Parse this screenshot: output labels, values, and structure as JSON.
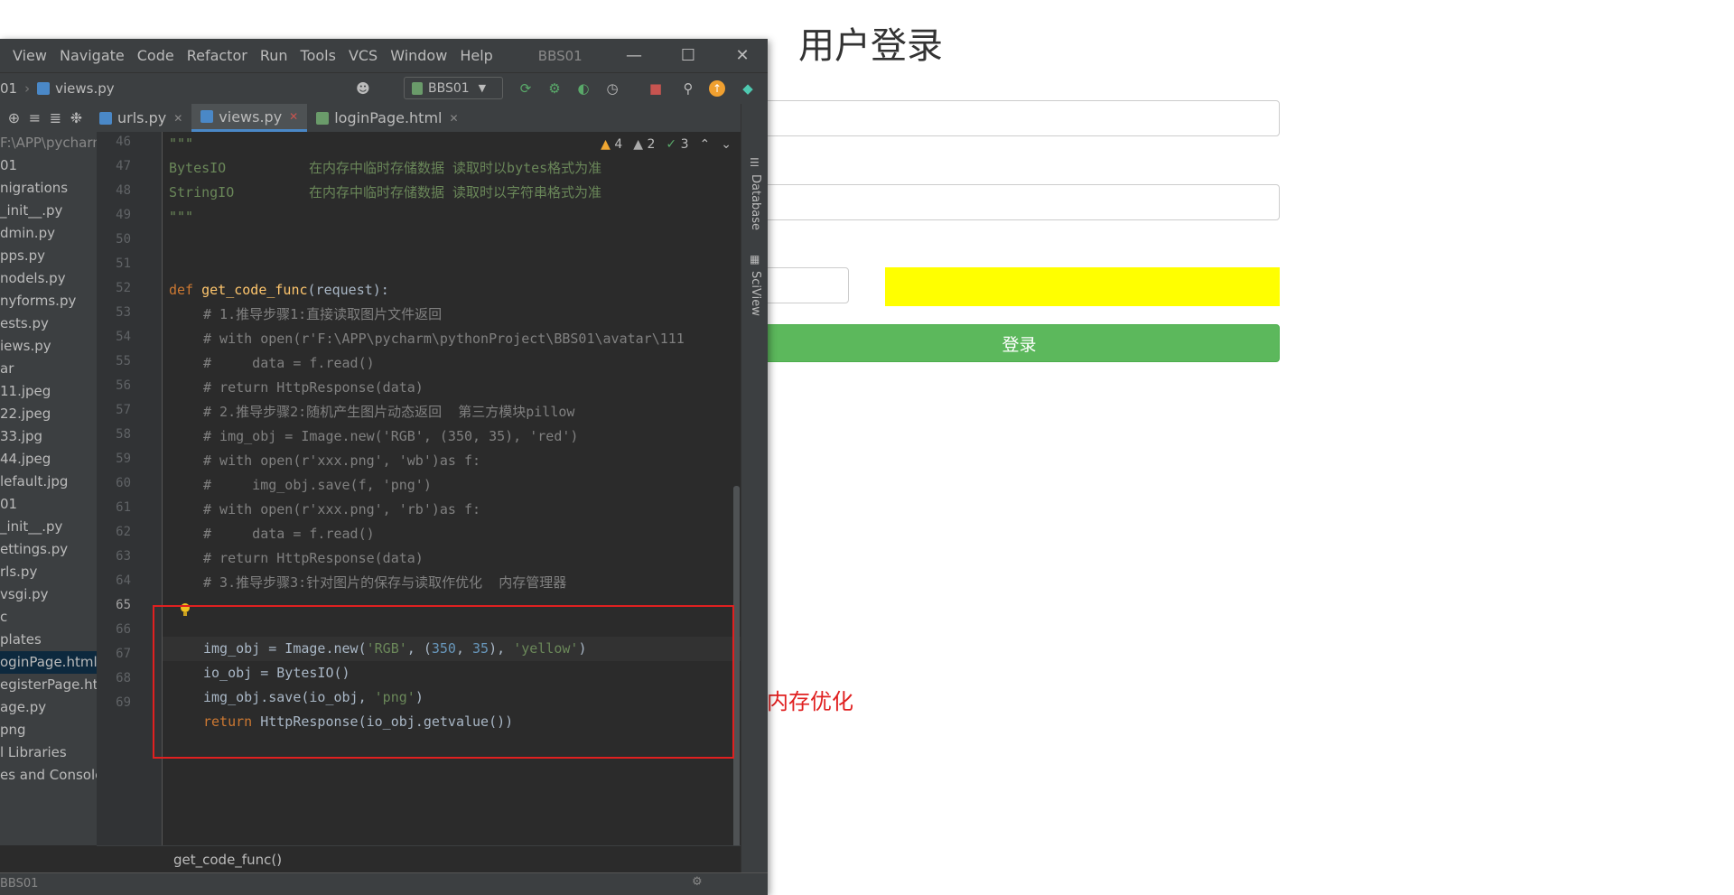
{
  "browser": {
    "title": "用户登录",
    "login_button": "登录",
    "annotation": "内存优化"
  },
  "ide": {
    "menu": [
      "View",
      "Navigate",
      "Code",
      "Refactor",
      "Run",
      "Tools",
      "VCS",
      "Window",
      "Help"
    ],
    "window_title": "BBS01",
    "nav_prefix": "01",
    "nav_file": "views.py",
    "run_config": "BBS01",
    "tabs": [
      {
        "label": "urls.py",
        "active": false
      },
      {
        "label": "views.py",
        "active": true
      },
      {
        "label": "loginPage.html",
        "active": false
      }
    ],
    "inspections": {
      "warnings": "4",
      "weak_warnings": "2",
      "ok": "3"
    },
    "project_tree": [
      "F:\\APP\\pycharm",
      "01",
      "nigrations",
      "_init__.py",
      "dmin.py",
      "pps.py",
      "nodels.py",
      "nyforms.py",
      "ests.py",
      "iews.py",
      "ar",
      "11.jpeg",
      "22.jpeg",
      "33.jpg",
      "44.jpeg",
      "lefault.jpg",
      "01",
      "_init__.py",
      "ettings.py",
      "rls.py",
      "vsgi.py",
      "c",
      "plates",
      "oginPage.html",
      "egisterPage.htm",
      "age.py",
      "png",
      "l Libraries",
      "es and Console"
    ],
    "selected_tree_item": "oginPage.html",
    "line_numbers": [
      "46",
      "47",
      "48",
      "49",
      "50",
      "51",
      "52",
      "53",
      "54",
      "55",
      "56",
      "57",
      "58",
      "59",
      "60",
      "61",
      "62",
      "63",
      "64",
      "65",
      "66",
      "67",
      "68",
      "69"
    ],
    "current_line": "65",
    "code": {
      "l46": "\"\"\"",
      "l47a": "BytesIO",
      "l47b": "在内存中临时存储数据 读取时以bytes格式为准",
      "l48a": "StringIO",
      "l48b": "在内存中临时存储数据 读取时以字符串格式为准",
      "l49": "\"\"\"",
      "l52_def": "def",
      "l52_fn": "get_code_func",
      "l52_rest": "(request):",
      "l53": "# 1.推导步骤1:直接读取图片文件返回",
      "l54": "# with open(r'F:\\APP\\pycharm\\pythonProject\\BBS01\\avatar\\111",
      "l55": "#     data = f.read()",
      "l56": "# return HttpResponse(data)",
      "l57": "# 2.推导步骤2:随机产生图片动态返回  第三方模块pillow",
      "l58": "# img_obj = Image.new('RGB', (350, 35), 'red')",
      "l59": "# with open(r'xxx.png', 'wb')as f:",
      "l60": "#     img_obj.save(f, 'png')",
      "l61": "# with open(r'xxx.png', 'rb')as f:",
      "l62": "#     data = f.read()",
      "l63": "# return HttpResponse(data)",
      "l64": "# 3.推导步骤3:针对图片的保存与读取作优化  内存管理器",
      "l65_a": "img_obj = Image.new(",
      "l65_s1": "'RGB'",
      "l65_b": ", (",
      "l65_n1": "350",
      "l65_c": ", ",
      "l65_n2": "35",
      "l65_d": "), ",
      "l65_s2": "'yellow'",
      "l65_e": ")",
      "l66": "io_obj = BytesIO()",
      "l67_a": "img_obj.save(io_obj, ",
      "l67_s": "'png'",
      "l67_b": ")",
      "l68_kw": "return",
      "l68_rest": " HttpResponse(io_obj.getvalue())"
    },
    "right_tools": [
      "Database",
      "SciView"
    ],
    "breadcrumb": "get_code_func()",
    "status_text": "BBS01"
  },
  "colors": {
    "captcha": "#ffff00",
    "login_button": "#5cb85c",
    "highlight_box": "#e02020"
  }
}
